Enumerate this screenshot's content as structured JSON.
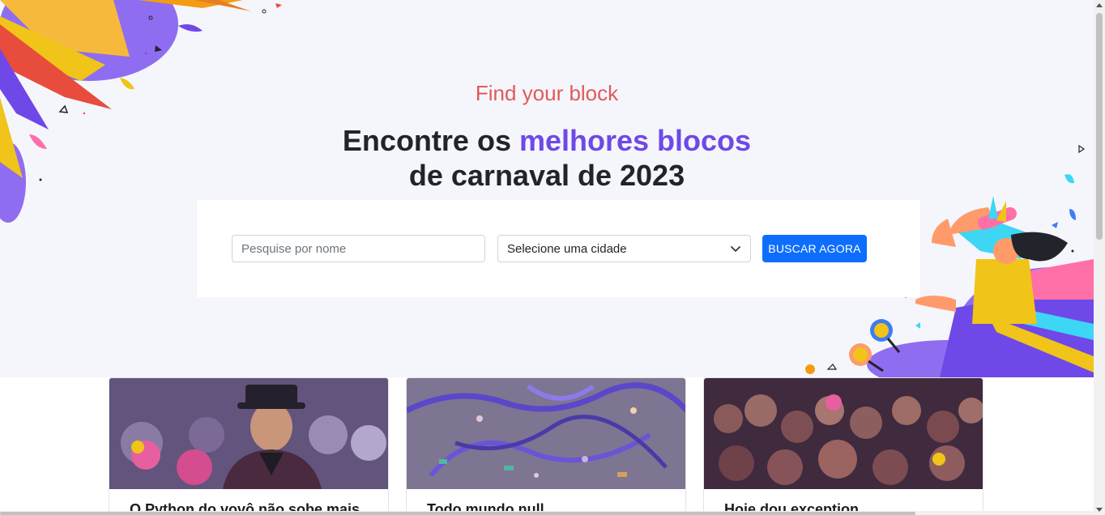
{
  "hero": {
    "subtitle": "Find your block",
    "title_line1_prefix": "Encontre os ",
    "title_line1_accent": "melhores blocos",
    "title_line2": "de carnaval de 2023"
  },
  "search": {
    "name_placeholder": "Pesquise por nome",
    "city_selected": "Selecione uma cidade",
    "button_label": "BUSCAR AGORA"
  },
  "cards": [
    {
      "title": "O Python do vovô não sobe mais"
    },
    {
      "title": "Todo mundo null"
    },
    {
      "title": "Hoje dou exception"
    }
  ],
  "colors": {
    "subtitle": "#e05a5a",
    "accent": "#6f48e8",
    "button": "#0d6efd",
    "hero_bg": "#f5f6fb"
  },
  "icons": [
    "chevron-down-icon",
    "feather-icon",
    "maracas-icon"
  ]
}
